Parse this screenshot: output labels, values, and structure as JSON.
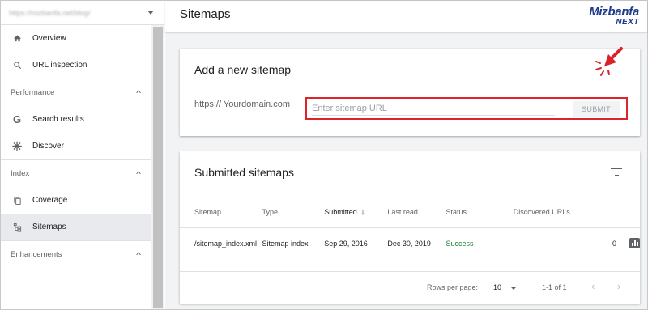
{
  "sidebar": {
    "property_url": "https://mizbanfa.net/blog/",
    "items_top": [
      {
        "label": "Overview",
        "icon": "home-icon"
      },
      {
        "label": "URL inspection",
        "icon": "search-icon"
      }
    ],
    "sections": [
      {
        "title": "Performance",
        "items": [
          {
            "label": "Search results",
            "icon": "google-g-icon"
          },
          {
            "label": "Discover",
            "icon": "asterisk-icon"
          }
        ]
      },
      {
        "title": "Index",
        "items": [
          {
            "label": "Coverage",
            "icon": "copy-icon"
          },
          {
            "label": "Sitemaps",
            "icon": "sitemap-icon"
          }
        ]
      },
      {
        "title": "Enhancements",
        "items": []
      }
    ]
  },
  "header": {
    "title": "Sitemaps",
    "logo_top": "Mizbanfa",
    "logo_bottom": "NEXT"
  },
  "add_sitemap": {
    "title": "Add a new sitemap",
    "prefix": "https:// Yourdomain.com",
    "placeholder": "Enter sitemap URL",
    "value": "",
    "submit_label": "SUBMIT"
  },
  "submitted": {
    "title": "Submitted sitemaps",
    "columns": [
      "Sitemap",
      "Type",
      "Submitted",
      "Last read",
      "Status",
      "Discovered URLs"
    ],
    "sort_arrow": "↓",
    "rows": [
      {
        "sitemap": "/sitemap_index.xml",
        "type": "Sitemap index",
        "submitted": "Sep 29, 2016",
        "last_read": "Dec 30, 2019",
        "status": "Success",
        "discovered": "0"
      }
    ],
    "footer": {
      "rows_per_page_label": "Rows per page:",
      "rows_per_page_value": "10",
      "range": "1-1 of 1",
      "prev": "‹",
      "next": "›"
    }
  },
  "colors": {
    "accent_highlight": "#e0232a",
    "success": "#188038",
    "logo": "#1e3a8a"
  }
}
